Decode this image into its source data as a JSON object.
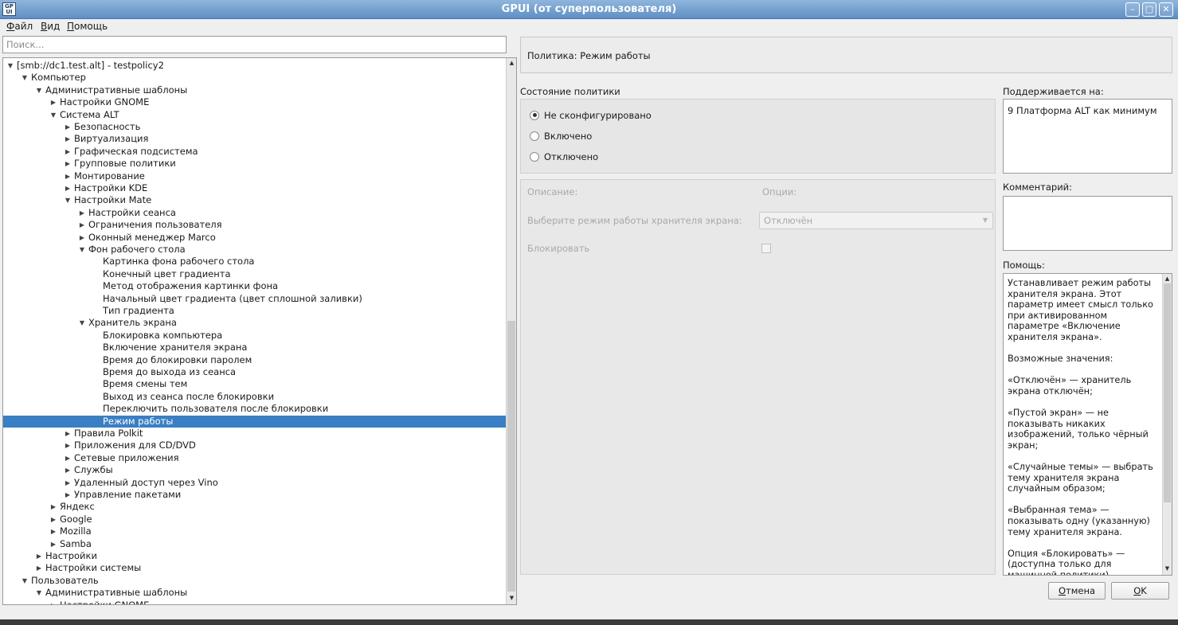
{
  "window": {
    "title": "GPUI (от суперпользователя)",
    "icon_text_top": "GP",
    "icon_text_bottom": "UI",
    "buttons": {
      "minimize": "–",
      "maximize": "□",
      "close": "✕"
    }
  },
  "menu": {
    "items": [
      "Файл",
      "Вид",
      "Помощь"
    ]
  },
  "search": {
    "placeholder": "Поиск..."
  },
  "tree": {
    "rows": [
      {
        "label": "[smb://dc1.test.alt] - testpolicy2",
        "level": 0,
        "state": "expanded"
      },
      {
        "label": "Компьютер",
        "level": 1,
        "state": "expanded"
      },
      {
        "label": "Административные шаблоны",
        "level": 2,
        "state": "expanded"
      },
      {
        "label": "Настройки GNOME",
        "level": 3,
        "state": "collapsed"
      },
      {
        "label": "Система ALT",
        "level": 3,
        "state": "expanded"
      },
      {
        "label": "Безопасность",
        "level": 4,
        "state": "collapsed"
      },
      {
        "label": "Виртуализация",
        "level": 4,
        "state": "collapsed"
      },
      {
        "label": "Графическая подсистема",
        "level": 4,
        "state": "collapsed"
      },
      {
        "label": "Групповые политики",
        "level": 4,
        "state": "collapsed"
      },
      {
        "label": "Монтирование",
        "level": 4,
        "state": "collapsed"
      },
      {
        "label": "Настройки KDE",
        "level": 4,
        "state": "collapsed"
      },
      {
        "label": "Настройки Mate",
        "level": 4,
        "state": "expanded"
      },
      {
        "label": "Настройки сеанса",
        "level": 5,
        "state": "collapsed"
      },
      {
        "label": "Ограничения пользователя",
        "level": 5,
        "state": "collapsed"
      },
      {
        "label": "Оконный менеджер Marco",
        "level": 5,
        "state": "collapsed"
      },
      {
        "label": "Фон рабочего стола",
        "level": 5,
        "state": "expanded"
      },
      {
        "label": "Картинка фона рабочего стола",
        "level": 6,
        "state": "leaf"
      },
      {
        "label": "Конечный цвет градиента",
        "level": 6,
        "state": "leaf"
      },
      {
        "label": "Метод отображения картинки фона",
        "level": 6,
        "state": "leaf"
      },
      {
        "label": "Начальный цвет градиента (цвет сплошной заливки)",
        "level": 6,
        "state": "leaf"
      },
      {
        "label": "Тип градиента",
        "level": 6,
        "state": "leaf"
      },
      {
        "label": "Хранитель экрана",
        "level": 5,
        "state": "expanded"
      },
      {
        "label": "Блокировка компьютера",
        "level": 6,
        "state": "leaf"
      },
      {
        "label": "Включение хранителя экрана",
        "level": 6,
        "state": "leaf"
      },
      {
        "label": "Время до блокировки паролем",
        "level": 6,
        "state": "leaf"
      },
      {
        "label": "Время до выхода из сеанса",
        "level": 6,
        "state": "leaf"
      },
      {
        "label": "Время смены тем",
        "level": 6,
        "state": "leaf"
      },
      {
        "label": "Выход из сеанса после блокировки",
        "level": 6,
        "state": "leaf"
      },
      {
        "label": "Переключить пользователя после блокировки",
        "level": 6,
        "state": "leaf"
      },
      {
        "label": "Режим работы",
        "level": 6,
        "state": "leaf",
        "selected": true
      },
      {
        "label": "Правила Polkit",
        "level": 4,
        "state": "collapsed"
      },
      {
        "label": "Приложения для CD/DVD",
        "level": 4,
        "state": "collapsed"
      },
      {
        "label": "Сетевые приложения",
        "level": 4,
        "state": "collapsed"
      },
      {
        "label": "Службы",
        "level": 4,
        "state": "collapsed"
      },
      {
        "label": "Удаленный доступ через Vino",
        "level": 4,
        "state": "collapsed"
      },
      {
        "label": "Управление пакетами",
        "level": 4,
        "state": "collapsed"
      },
      {
        "label": "Яндекс",
        "level": 3,
        "state": "collapsed"
      },
      {
        "label": "Google",
        "level": 3,
        "state": "collapsed"
      },
      {
        "label": "Mozilla",
        "level": 3,
        "state": "collapsed"
      },
      {
        "label": "Samba",
        "level": 3,
        "state": "collapsed"
      },
      {
        "label": "Настройки",
        "level": 2,
        "state": "collapsed"
      },
      {
        "label": "Настройки системы",
        "level": 2,
        "state": "collapsed"
      },
      {
        "label": "Пользователь",
        "level": 1,
        "state": "expanded"
      },
      {
        "label": "Административные шаблоны",
        "level": 2,
        "state": "expanded"
      },
      {
        "label": "Настройки GNOME",
        "level": 3,
        "state": "collapsed"
      }
    ]
  },
  "policy": {
    "title": "Политика: Режим работы",
    "state_label": "Состояние политики",
    "states": [
      {
        "label": "Не сконфигурировано",
        "checked": true
      },
      {
        "label": "Включено",
        "checked": false
      },
      {
        "label": "Отключено",
        "checked": false
      }
    ],
    "description_label": "Описание:",
    "options_label": "Опции:",
    "mode_label": "Выберите режим работы хранителя экрана:",
    "mode_value": "Отключён",
    "lock_label": "Блокировать"
  },
  "supported": {
    "label": "Поддерживается на:",
    "value": "9 Платформа ALT как минимум"
  },
  "comment": {
    "label": "Комментарий:",
    "value": ""
  },
  "help": {
    "label": "Помощь:",
    "paragraphs": [
      "Устанавливает режим работы хранителя экрана. Этот параметр имеет смысл только при активированном параметре «Включение хранителя экрана».",
      "Возможные значения:",
      "«Отключён» — хранитель экрана отключён;",
      "«Пустой экран» — не показывать никаких изображений, только чёрный экран;",
      "«Случайные темы» — выбрать тему хранителя экрана случайным образом;",
      "«Выбранная тема» — показывать одну (указанную) тему хранителя экрана.",
      "Опция «Блокировать» — (доступна только для машинной политики)"
    ]
  },
  "buttons": {
    "cancel": "Отмена",
    "ok": "OK"
  }
}
